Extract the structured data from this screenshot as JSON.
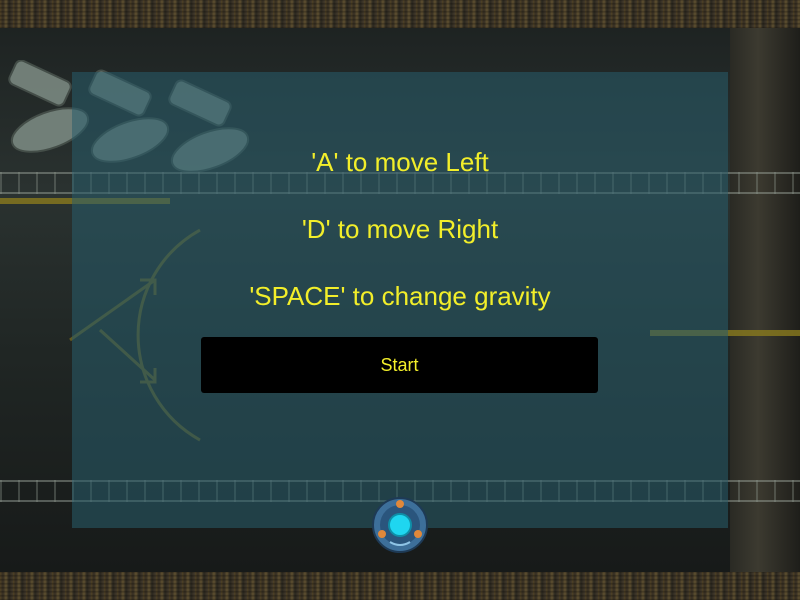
{
  "instructions": {
    "move_left": "'A' to move Left",
    "move_right": "'D' to move Right",
    "change_gravity": "'SPACE' to change gravity"
  },
  "start_button": {
    "label": "Start"
  },
  "colors": {
    "text_accent": "#f2ee2a",
    "panel_overlay": "#285c6c",
    "button_bg": "#000000"
  },
  "icons": {
    "player_orb": "player-orb-icon"
  }
}
